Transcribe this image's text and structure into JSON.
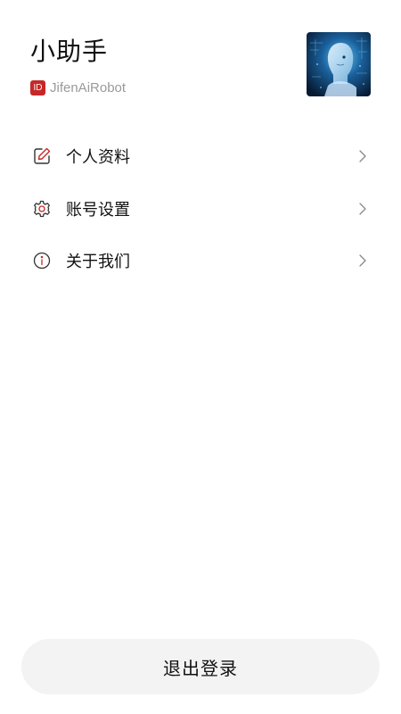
{
  "profile": {
    "name": "小助手",
    "id_badge": "ID",
    "id_value": "JifenAiRobot",
    "avatar_icon": "robot-portrait-avatar"
  },
  "menu": {
    "items": [
      {
        "label": "个人资料",
        "icon": "edit-icon"
      },
      {
        "label": "账号设置",
        "icon": "gear-icon"
      },
      {
        "label": "关于我们",
        "icon": "info-icon"
      }
    ]
  },
  "logout": {
    "label": "退出登录"
  },
  "colors": {
    "accent": "#c62828",
    "muted": "#9a9a9a",
    "button_bg": "#f3f3f3"
  }
}
